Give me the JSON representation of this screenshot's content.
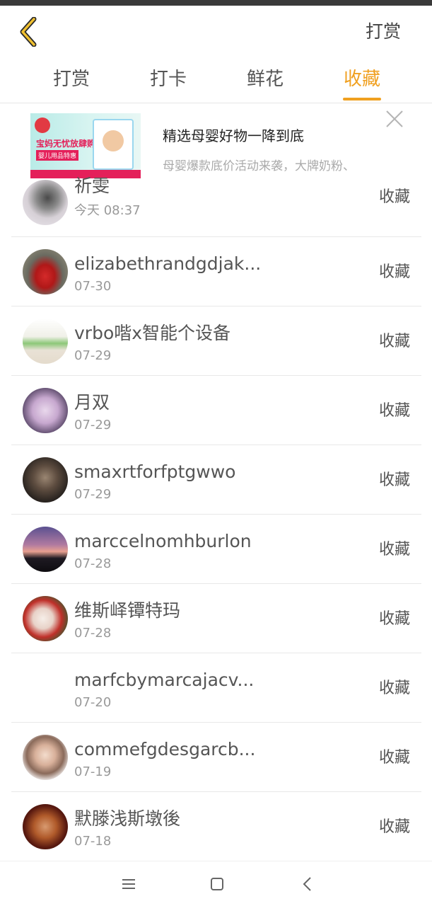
{
  "header": {
    "action_label": "打赏"
  },
  "tabs": [
    {
      "label": "打赏",
      "active": false
    },
    {
      "label": "打卡",
      "active": false
    },
    {
      "label": "鲜花",
      "active": false
    },
    {
      "label": "收藏",
      "active": true
    }
  ],
  "ad": {
    "title": "精选母婴好物一降到底",
    "description": "母婴爆款底价活动来袭，大牌奶粉、",
    "image_text_1": "宝妈无忧放肆购",
    "image_text_2": "婴儿用品特惠",
    "image_brand": "唯品会"
  },
  "list": {
    "items": [
      {
        "name": "祈雯",
        "time": "今天 08:37",
        "action": "收藏"
      },
      {
        "name": "elizabethrandgdjak...",
        "time": "07-30",
        "action": "收藏"
      },
      {
        "name": "vrbo喈x智能个设备",
        "time": "07-29",
        "action": "收藏"
      },
      {
        "name": "月双",
        "time": "07-29",
        "action": "收藏"
      },
      {
        "name": "smaxrtforfptgwwo",
        "time": "07-29",
        "action": "收藏"
      },
      {
        "name": "marccelnomhburlon",
        "time": "07-28",
        "action": "收藏"
      },
      {
        "name": "维斯峄镡特玛",
        "time": "07-28",
        "action": "收藏"
      },
      {
        "name": "marfcbymarcajacv...",
        "time": "07-20",
        "action": "收藏"
      },
      {
        "name": "commefgdesgarcb...",
        "time": "07-19",
        "action": "收藏"
      },
      {
        "name": "默滕浅斯墩後",
        "time": "07-18",
        "action": "收藏"
      }
    ]
  },
  "colors": {
    "accent": "#f0a020",
    "text_primary": "#555555",
    "text_secondary": "#999999",
    "divider": "#e8e8e8"
  }
}
